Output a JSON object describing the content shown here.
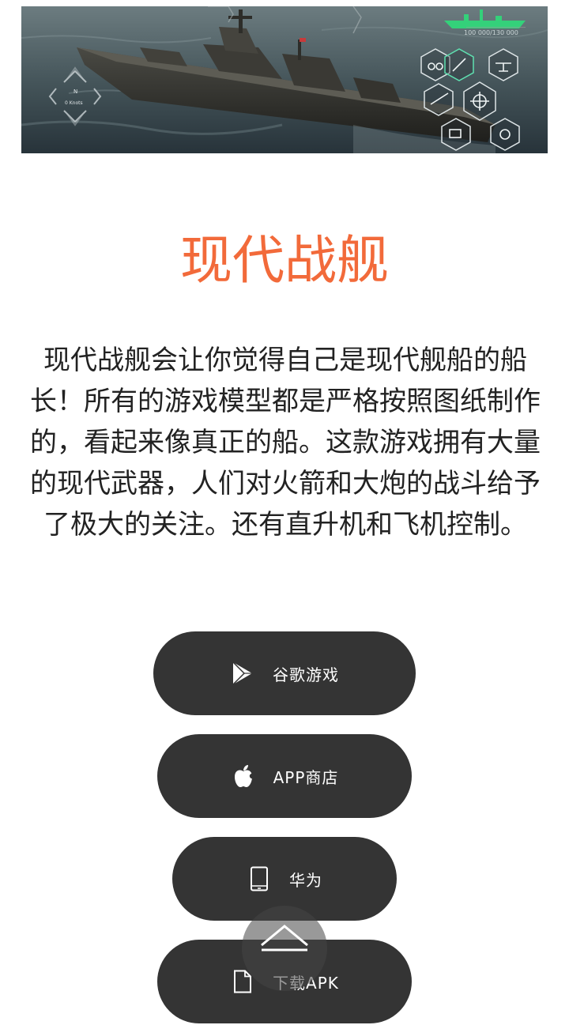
{
  "banner": {
    "ship_counter": "100 000/130 000",
    "compass_label": "N",
    "speed_label": "0 Knots"
  },
  "title": "现代战舰",
  "description": "现代战舰会让你觉得自己是现代舰船的船长！所有的游戏模型都是严格按照图纸制作的，看起来像真正的船。这款游戏拥有大量的现代武器，人们对火箭和大炮的战斗给予了极大的关注。还有直升机和飞机控制。",
  "buttons": {
    "google": "谷歌游戏",
    "apple": "APP商店",
    "huawei": "华为",
    "apk": "下载APK"
  },
  "colors": {
    "title": "#f26a3a",
    "button_bg": "#343434",
    "button_text": "#ffffff"
  },
  "icons": {
    "google": "google-play-icon",
    "apple": "apple-icon",
    "huawei": "tablet-icon",
    "apk": "file-icon",
    "scroll_top": "chevron-up-icon"
  }
}
